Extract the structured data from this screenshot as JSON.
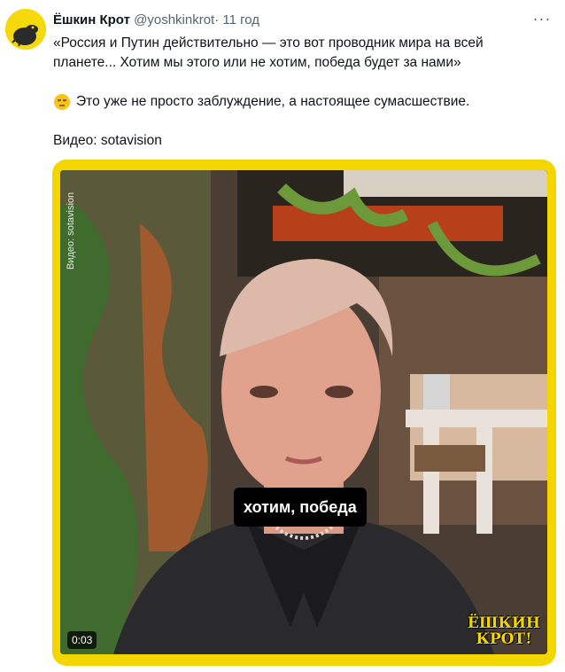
{
  "tweet": {
    "author_name": "Ёшкин Крот",
    "handle": "@yoshkinkrot",
    "separator": "·",
    "time": "11 год",
    "more_glyph": "···",
    "text_line1": "«Россия и Путин действительно — это вот проводник мира на всей планете... Хотим мы этого или не хотим, победа будет за нами»",
    "text_line2": "Это уже не просто заблуждение, а настоящее сумасшествие.",
    "text_line3": "Видео: sotavision"
  },
  "media": {
    "side_credit": "Видео: sotavision",
    "caption": "хотим, победа",
    "duration": "0:03",
    "watermark_line1": "ЁШКИН",
    "watermark_line2": "КРОТ!",
    "frame_color": "#f3d600",
    "icons": {
      "avatar": "mole-avatar-icon",
      "more": "more-horizontal-icon",
      "emoji": "unamused-face-icon"
    }
  }
}
